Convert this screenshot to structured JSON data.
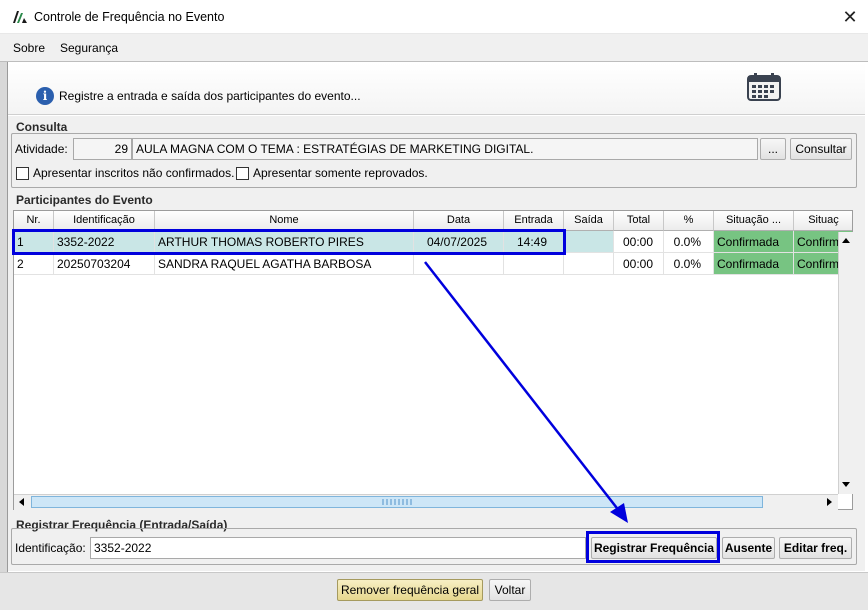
{
  "window": {
    "title": "Controle de Frequência no Evento",
    "close_glyph": "✕"
  },
  "menu": {
    "items": [
      {
        "label": "Sobre"
      },
      {
        "label": "Segurança"
      }
    ]
  },
  "banner": {
    "text": "Registre a entrada e saída dos participantes do evento...",
    "info_glyph": "i",
    "icon": "calendar-icon"
  },
  "consulta": {
    "title": "Consulta",
    "atividade_label": "Atividade:",
    "atividade_code": "29",
    "atividade_desc": "AULA MAGNA COM O TEMA : ESTRATÉGIAS DE MARKETING DIGITAL.",
    "browse_label": "...",
    "consultar_label": "Consultar",
    "check_nao_confirmados": "Apresentar inscritos não confirmados.",
    "check_reprovados": "Apresentar somente reprovados."
  },
  "participantes": {
    "title": "Participantes do Evento",
    "columns": [
      "Nr.",
      "Identificação",
      "Nome",
      "Data",
      "Entrada",
      "Saída",
      "Total",
      "%",
      "Situação ...",
      "Situaç"
    ],
    "rows": [
      {
        "nr": "1",
        "id": "3352-2022",
        "nome": "ARTHUR THOMAS ROBERTO PIRES",
        "data": "04/07/2025",
        "entrada": "14:49",
        "saida": "",
        "total": "00:00",
        "pct": "0.0%",
        "sit1": "Confirmada",
        "sit2": "Confirm"
      },
      {
        "nr": "2",
        "id": "20250703204",
        "nome": "SANDRA RAQUEL AGATHA BARBOSA",
        "data": "",
        "entrada": "",
        "saida": "",
        "total": "00:00",
        "pct": "0.0%",
        "sit1": "Confirmada",
        "sit2": "Confirm"
      }
    ]
  },
  "registrar": {
    "title": "Registrar Frequência (Entrada/Saída)",
    "id_label": "Identificação:",
    "id_value": "3352-2022",
    "registrar_label": "Registrar Frequência",
    "ausente_label": "Ausente",
    "editar_label": "Editar freq."
  },
  "footer": {
    "remover_label": "Remover frequência geral",
    "voltar_label": "Voltar"
  },
  "colors": {
    "selected_row": "#c9e6e6",
    "confirmed_cell": "#77c482",
    "annotation": "#0000dd"
  }
}
